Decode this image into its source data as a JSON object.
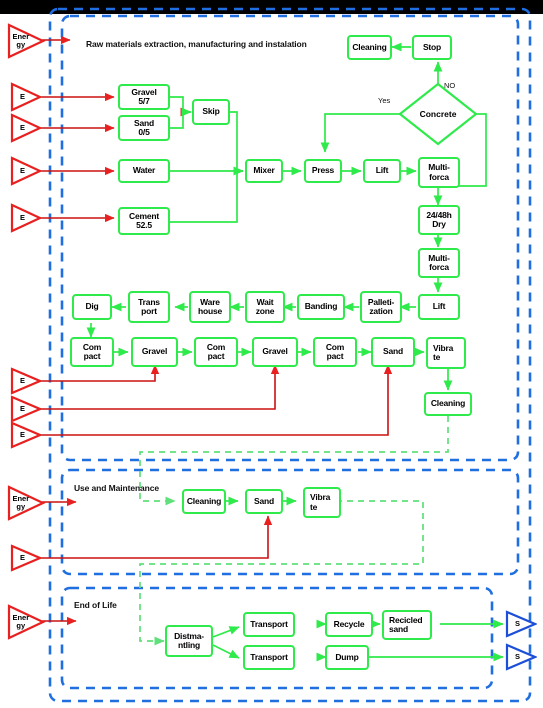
{
  "diagram": {
    "title": "Concrete paving block life cycle flow diagram",
    "colors": {
      "process_box_border": "#2eea4a",
      "material_flow": "#2eea4a",
      "energy_flow": "#e8201f",
      "system_boundary": "#1f6fe0",
      "output_marker": "#1c4fd8",
      "header_bar": "#000000"
    },
    "phases": [
      {
        "id": "raw",
        "label": "Raw materials extraction, manufacturing and instalation"
      },
      {
        "id": "use",
        "label": "Use and Maintenance"
      },
      {
        "id": "eol",
        "label": "End of Life"
      }
    ],
    "edge_labels": [
      {
        "id": "yes",
        "text": "Yes"
      },
      {
        "id": "no",
        "text": "NO"
      }
    ],
    "energy_inputs": [
      {
        "id": "e-top",
        "label": "Ener\ngy"
      },
      {
        "id": "e-1",
        "label": "E"
      },
      {
        "id": "e-2",
        "label": "E"
      },
      {
        "id": "e-3",
        "label": "E"
      },
      {
        "id": "e-4",
        "label": "E"
      },
      {
        "id": "e-5",
        "label": "E"
      },
      {
        "id": "e-6",
        "label": "E"
      },
      {
        "id": "e-7",
        "label": "E"
      },
      {
        "id": "e-use",
        "label": "Ener\ngy"
      },
      {
        "id": "e-use2",
        "label": "E"
      },
      {
        "id": "e-eol",
        "label": "Ener\ngy"
      }
    ],
    "outputs": [
      {
        "id": "s-1",
        "label": "S"
      },
      {
        "id": "s-2",
        "label": "S"
      }
    ],
    "nodes": {
      "gravel57": {
        "line1": "Gravel",
        "line2": "5/7"
      },
      "sand05": {
        "line1": "Sand",
        "line2": "0/5"
      },
      "water": {
        "line1": "Water",
        "line2": ""
      },
      "cement525": {
        "line1": "Cement",
        "line2": "52.5"
      },
      "skip": {
        "line1": "Skip",
        "line2": ""
      },
      "mixer": {
        "line1": "Mixer",
        "line2": ""
      },
      "press": {
        "line1": "Press",
        "line2": ""
      },
      "lift1": {
        "line1": "Lift",
        "line2": ""
      },
      "multiforca1": {
        "line1": "Multi-",
        "line2": "forca"
      },
      "dry": {
        "line1": "24/48h",
        "line2": "Dry"
      },
      "multiforca2": {
        "line1": "Multi-",
        "line2": "forca"
      },
      "lift2": {
        "line1": "Lift",
        "line2": ""
      },
      "concrete": {
        "line1": "Concrete"
      },
      "stop": {
        "line1": "Stop",
        "line2": ""
      },
      "cleaning1": {
        "line1": "Cleaning",
        "line2": ""
      },
      "palletization": {
        "line1": "Palleti-",
        "line2": "zation"
      },
      "banding": {
        "line1": "Banding",
        "line2": ""
      },
      "waitzone": {
        "line1": "Wait",
        "line2": "zone"
      },
      "warehouse": {
        "line1": "Ware",
        "line2": "house"
      },
      "transport0": {
        "line1": "Trans",
        "line2": "port"
      },
      "dig": {
        "line1": "Dig",
        "line2": ""
      },
      "compact1": {
        "line1": "Com",
        "line2": "pact"
      },
      "gravelA": {
        "line1": "Gravel",
        "line2": ""
      },
      "compact2": {
        "line1": "Com",
        "line2": "pact"
      },
      "gravelB": {
        "line1": "Gravel",
        "line2": ""
      },
      "compact3": {
        "line1": "Com",
        "line2": "pact"
      },
      "sandA": {
        "line1": "Sand",
        "line2": ""
      },
      "vibrate1": {
        "line1": "Vibra",
        "line2": "te"
      },
      "cleaning2": {
        "line1": "Cleaning",
        "line2": ""
      },
      "cleaning3": {
        "line1": "Cleaning",
        "line2": ""
      },
      "sandB": {
        "line1": "Sand",
        "line2": ""
      },
      "vibrate2": {
        "line1": "Vibra",
        "line2": "te"
      },
      "dismantling": {
        "line1": "Distma-",
        "line2": "ntling"
      },
      "transport1": {
        "line1": "Transport",
        "line2": ""
      },
      "transport2": {
        "line1": "Transport",
        "line2": ""
      },
      "recycle": {
        "line1": "Recycle",
        "line2": ""
      },
      "recicledsand": {
        "line1": "Recicled",
        "line2": "sand"
      },
      "dump": {
        "line1": "Dump",
        "line2": ""
      }
    }
  }
}
